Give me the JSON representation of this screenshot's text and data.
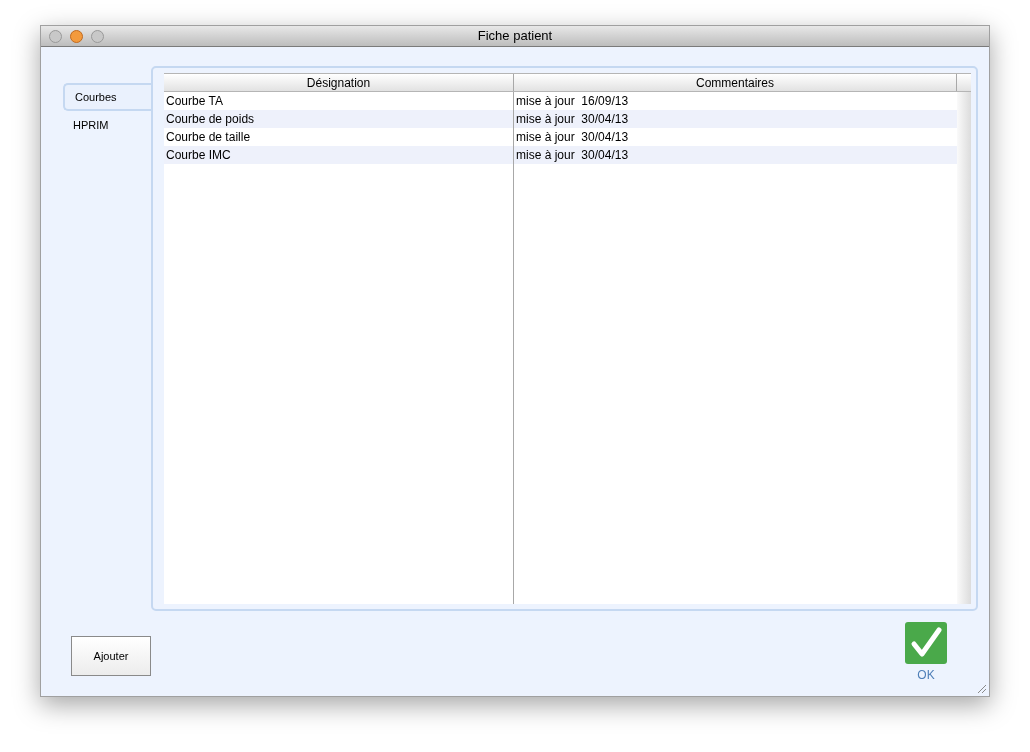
{
  "window": {
    "title": "Fiche patient"
  },
  "tabs": [
    {
      "label": "Courbes",
      "selected": true
    },
    {
      "label": "HPRIM",
      "selected": false
    }
  ],
  "table": {
    "columns": [
      "Désignation",
      "Commentaires"
    ],
    "rows": [
      [
        "Courbe TA",
        "mise à jour  16/09/13"
      ],
      [
        "Courbe de poids",
        "mise à jour  30/04/13"
      ],
      [
        "Courbe de taille",
        "mise à jour  30/04/13"
      ],
      [
        "Courbe IMC",
        "mise à jour  30/04/13"
      ]
    ]
  },
  "buttons": {
    "add": "Ajouter",
    "ok": "OK"
  }
}
